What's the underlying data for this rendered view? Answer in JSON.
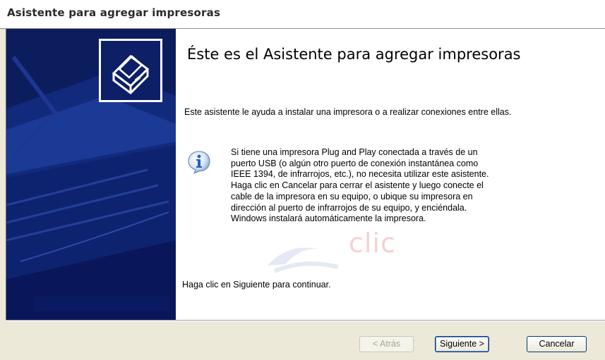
{
  "window": {
    "title": "Asistente para agregar impresoras"
  },
  "welcome": {
    "heading": "Éste es el Asistente para agregar impresoras",
    "intro": "Este asistente le ayuda a instalar una impresora o a realizar conexiones entre ellas.",
    "info": "Si tiene una impresora Plug and Play conectada a través de un puerto USB (o algún otro puerto de conexión instantánea como IEEE 1394, de infrarrojos, etc.), no necesita utilizar este asistente. Haga clic en Cancelar para cerrar el asistente y luego conecte el cable de la impresora en su equipo, o ubique su impresora en dirección al puerto de infrarrojos de su equipo, y enciéndala. Windows instalará automáticamente la impresora.",
    "continue": "Haga clic en Siguiente para continuar.",
    "watermark": "clic"
  },
  "buttons": {
    "back": "< Atrás",
    "next": "Siguiente >",
    "cancel": "Cancelar"
  },
  "icons": {
    "side_logo": "printer-wizard-icon",
    "info": "info-icon"
  },
  "colors": {
    "sidebar": "#0c1d5e",
    "dialog": "#ece9d8",
    "accent": "#1f5fc4"
  }
}
